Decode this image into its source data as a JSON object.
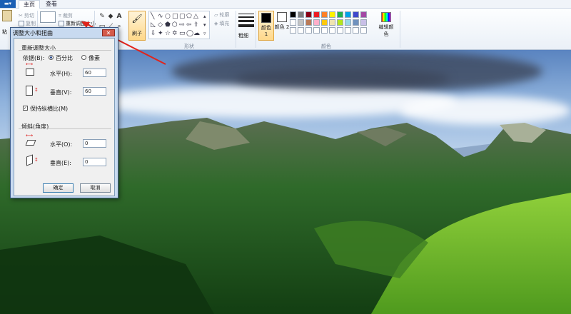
{
  "tabs": {
    "file": "▬▾",
    "home": "主页",
    "view": "查看"
  },
  "clipboard": {
    "paste": "粘",
    "cut": "剪切",
    "copy": "复制"
  },
  "image": {
    "crop": "裁剪",
    "resize": "重新调整大小"
  },
  "tools": {
    "text_tool": "A"
  },
  "brushes": {
    "label": "刷子"
  },
  "shapes": {
    "outline": "轮廓",
    "fill": "填充",
    "group_label": "形状"
  },
  "size": {
    "label": "粗细"
  },
  "colors": {
    "color1_label": "颜色 1",
    "color2_label": "颜色 2",
    "edit_label": "编辑颜色",
    "group_label": "颜色",
    "color1": "#000000",
    "color2": "#ffffff",
    "palette_row1": [
      "#000000",
      "#7f7f7f",
      "#880015",
      "#ed1c24",
      "#ff7f27",
      "#fff200",
      "#22b14c",
      "#00a2e8",
      "#3f48cc",
      "#a349a4"
    ],
    "palette_row2": [
      "#ffffff",
      "#c3c3c3",
      "#b97a57",
      "#ffaec9",
      "#ffc90e",
      "#efe4b0",
      "#b5e61d",
      "#99d9ea",
      "#7092be",
      "#c8bfe7"
    ]
  },
  "dialog": {
    "title": "调整大小和扭曲",
    "close_glyph": "✕",
    "resize_section": "重新调整大小",
    "by_label": "依据(B):",
    "percent_label": "百分比",
    "pixels_label": "像素",
    "horizontal_label": "水平(H):",
    "horizontal_value": "60",
    "vertical_label": "垂直(V):",
    "vertical_value": "60",
    "keep_ratio_label": "保持纵横比(M)",
    "skew_section": "倾斜(角度)",
    "skew_h_label": "水平(O):",
    "skew_h_value": "0",
    "skew_v_label": "垂直(E):",
    "skew_v_value": "0",
    "ok_label": "确定",
    "cancel_label": "取消"
  }
}
